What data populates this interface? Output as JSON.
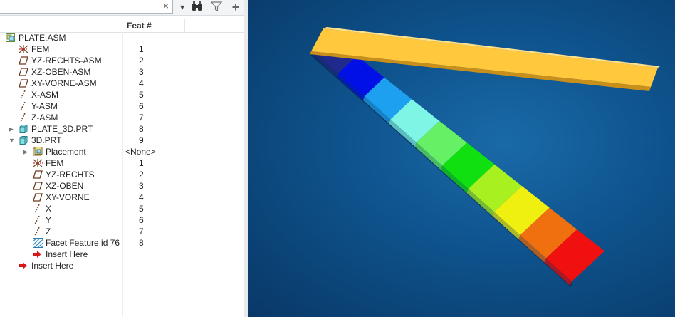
{
  "search": {
    "placeholder": "",
    "value": "",
    "clear_glyph": "×"
  },
  "toolbar": {
    "dropdown_glyph": "▾",
    "find_glyph": "⌕",
    "filter_glyph": "▽",
    "add_glyph": "+"
  },
  "header": {
    "feat_label": "Feat #"
  },
  "tree": {
    "items": [
      {
        "label": "PLATE.ASM",
        "feat": "",
        "icon": "assembly-icon",
        "depth": 0,
        "arrow": ""
      },
      {
        "label": "FEM",
        "feat": "1",
        "icon": "coordinate-system-icon",
        "depth": 1,
        "arrow": ""
      },
      {
        "label": "YZ-RECHTS-ASM",
        "feat": "2",
        "icon": "datum-plane-icon",
        "depth": 1,
        "arrow": ""
      },
      {
        "label": "XZ-OBEN-ASM",
        "feat": "3",
        "icon": "datum-plane-icon",
        "depth": 1,
        "arrow": ""
      },
      {
        "label": "XY-VORNE-ASM",
        "feat": "4",
        "icon": "datum-plane-icon",
        "depth": 1,
        "arrow": ""
      },
      {
        "label": "X-ASM",
        "feat": "5",
        "icon": "datum-axis-icon",
        "depth": 1,
        "arrow": ""
      },
      {
        "label": "Y-ASM",
        "feat": "6",
        "icon": "datum-axis-icon",
        "depth": 1,
        "arrow": ""
      },
      {
        "label": "Z-ASM",
        "feat": "7",
        "icon": "datum-axis-icon",
        "depth": 1,
        "arrow": ""
      },
      {
        "label": "PLATE_3D.PRT",
        "feat": "8",
        "icon": "part-icon",
        "depth": 1,
        "arrow": "collapsed"
      },
      {
        "label": "3D.PRT",
        "feat": "9",
        "icon": "part-icon",
        "depth": 1,
        "arrow": "expanded"
      },
      {
        "label": "Placement",
        "feat": "<None>",
        "icon": "placement-icon",
        "depth": 2,
        "arrow": "collapsed"
      },
      {
        "label": "FEM",
        "feat": "1",
        "icon": "coordinate-system-icon",
        "depth": 2,
        "arrow": ""
      },
      {
        "label": "YZ-RECHTS",
        "feat": "2",
        "icon": "datum-plane-icon",
        "depth": 2,
        "arrow": ""
      },
      {
        "label": "XZ-OBEN",
        "feat": "3",
        "icon": "datum-plane-icon",
        "depth": 2,
        "arrow": ""
      },
      {
        "label": "XY-VORNE",
        "feat": "4",
        "icon": "datum-plane-icon",
        "depth": 2,
        "arrow": ""
      },
      {
        "label": "X",
        "feat": "5",
        "icon": "datum-axis-icon",
        "depth": 2,
        "arrow": ""
      },
      {
        "label": "Y",
        "feat": "6",
        "icon": "datum-axis-icon",
        "depth": 2,
        "arrow": ""
      },
      {
        "label": "Z",
        "feat": "7",
        "icon": "datum-axis-icon",
        "depth": 2,
        "arrow": ""
      },
      {
        "label": "Facet Feature id 76",
        "feat": "8",
        "icon": "facet-feature-icon",
        "depth": 2,
        "arrow": ""
      },
      {
        "label": "Insert Here",
        "feat": "",
        "icon": "insert-arrow-icon",
        "depth": 2,
        "arrow": ""
      },
      {
        "label": "Insert Here",
        "feat": "",
        "icon": "insert-arrow-icon",
        "depth": 1,
        "arrow": ""
      }
    ]
  },
  "viewport": {
    "background": "#0f5590",
    "plate_color": "#ffc83d",
    "segment_colors": [
      "#1f2a8c",
      "#0010e6",
      "#1ea0f0",
      "#7ff5e6",
      "#66f066",
      "#10e010",
      "#a8f020",
      "#f0f010",
      "#f07010",
      "#f01010"
    ]
  }
}
